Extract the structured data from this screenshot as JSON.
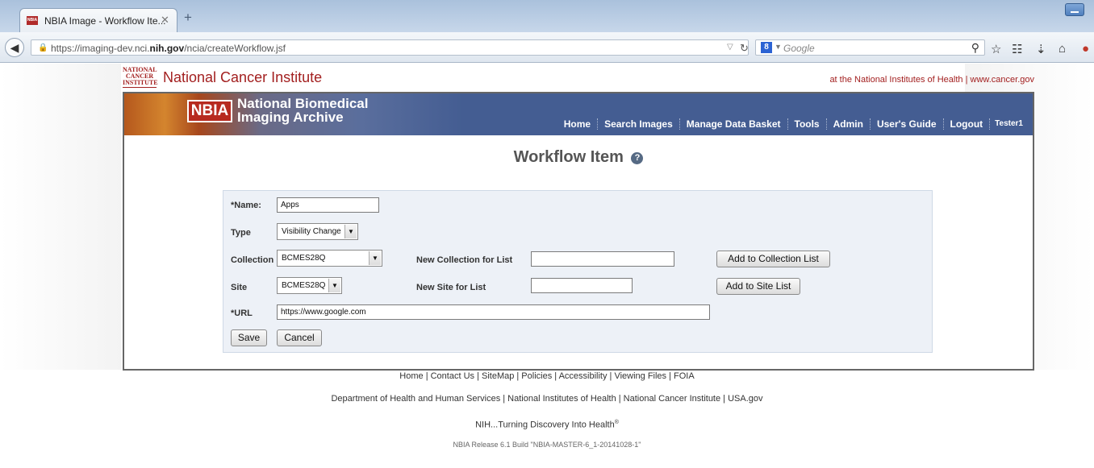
{
  "browser": {
    "tab_title": "NBIA Image - Workflow Ite...",
    "tab_favicon": "NBIA",
    "url_prefix": "https://imaging-dev.nci.",
    "url_domain": "nih.gov",
    "url_suffix": "/ncia/createWorkflow.jsf",
    "search_engine": "8",
    "search_placeholder": "Google"
  },
  "header": {
    "logo_text": "NATIONAL CANCER INSTITUTE",
    "org_name": "National Cancer Institute",
    "tagline": "at the National Institutes of Health | www.cancer.gov"
  },
  "banner": {
    "logo": "NBIA",
    "title_line1": "National Biomedical",
    "title_line2": "Imaging Archive",
    "nav": [
      "Home",
      "Search Images",
      "Manage Data Basket",
      "Tools",
      "Admin",
      "User's Guide",
      "Logout"
    ],
    "user": "Tester1"
  },
  "page": {
    "title": "Workflow Item"
  },
  "form": {
    "name_label": "*Name:",
    "name_value": "Apps",
    "type_label": "Type",
    "type_value": "Visibility Change",
    "collection_label": "Collection",
    "collection_value": "BCMES28Q",
    "new_collection_label": "New Collection for List",
    "new_collection_value": "",
    "add_collection_button": "Add to Collection List",
    "site_label": "Site",
    "site_value": "BCMES28Q",
    "new_site_label": "New Site for List",
    "new_site_value": "",
    "add_site_button": "Add to Site List",
    "url_label": "*URL",
    "url_value": "https://www.google.com",
    "save_button": "Save",
    "cancel_button": "Cancel"
  },
  "footer": {
    "links": "Home | Contact Us | SiteMap | Policies | Accessibility | Viewing Files | FOIA",
    "gov": "Department of Health and Human Services | National Institutes of Health | National Cancer Institute | USA.gov",
    "slogan": "NIH...Turning Discovery Into Health",
    "slogan_mark": "®",
    "release": "NBIA Release 6.1 Build \"NBIA-MASTER-6_1-20141028-1\""
  }
}
